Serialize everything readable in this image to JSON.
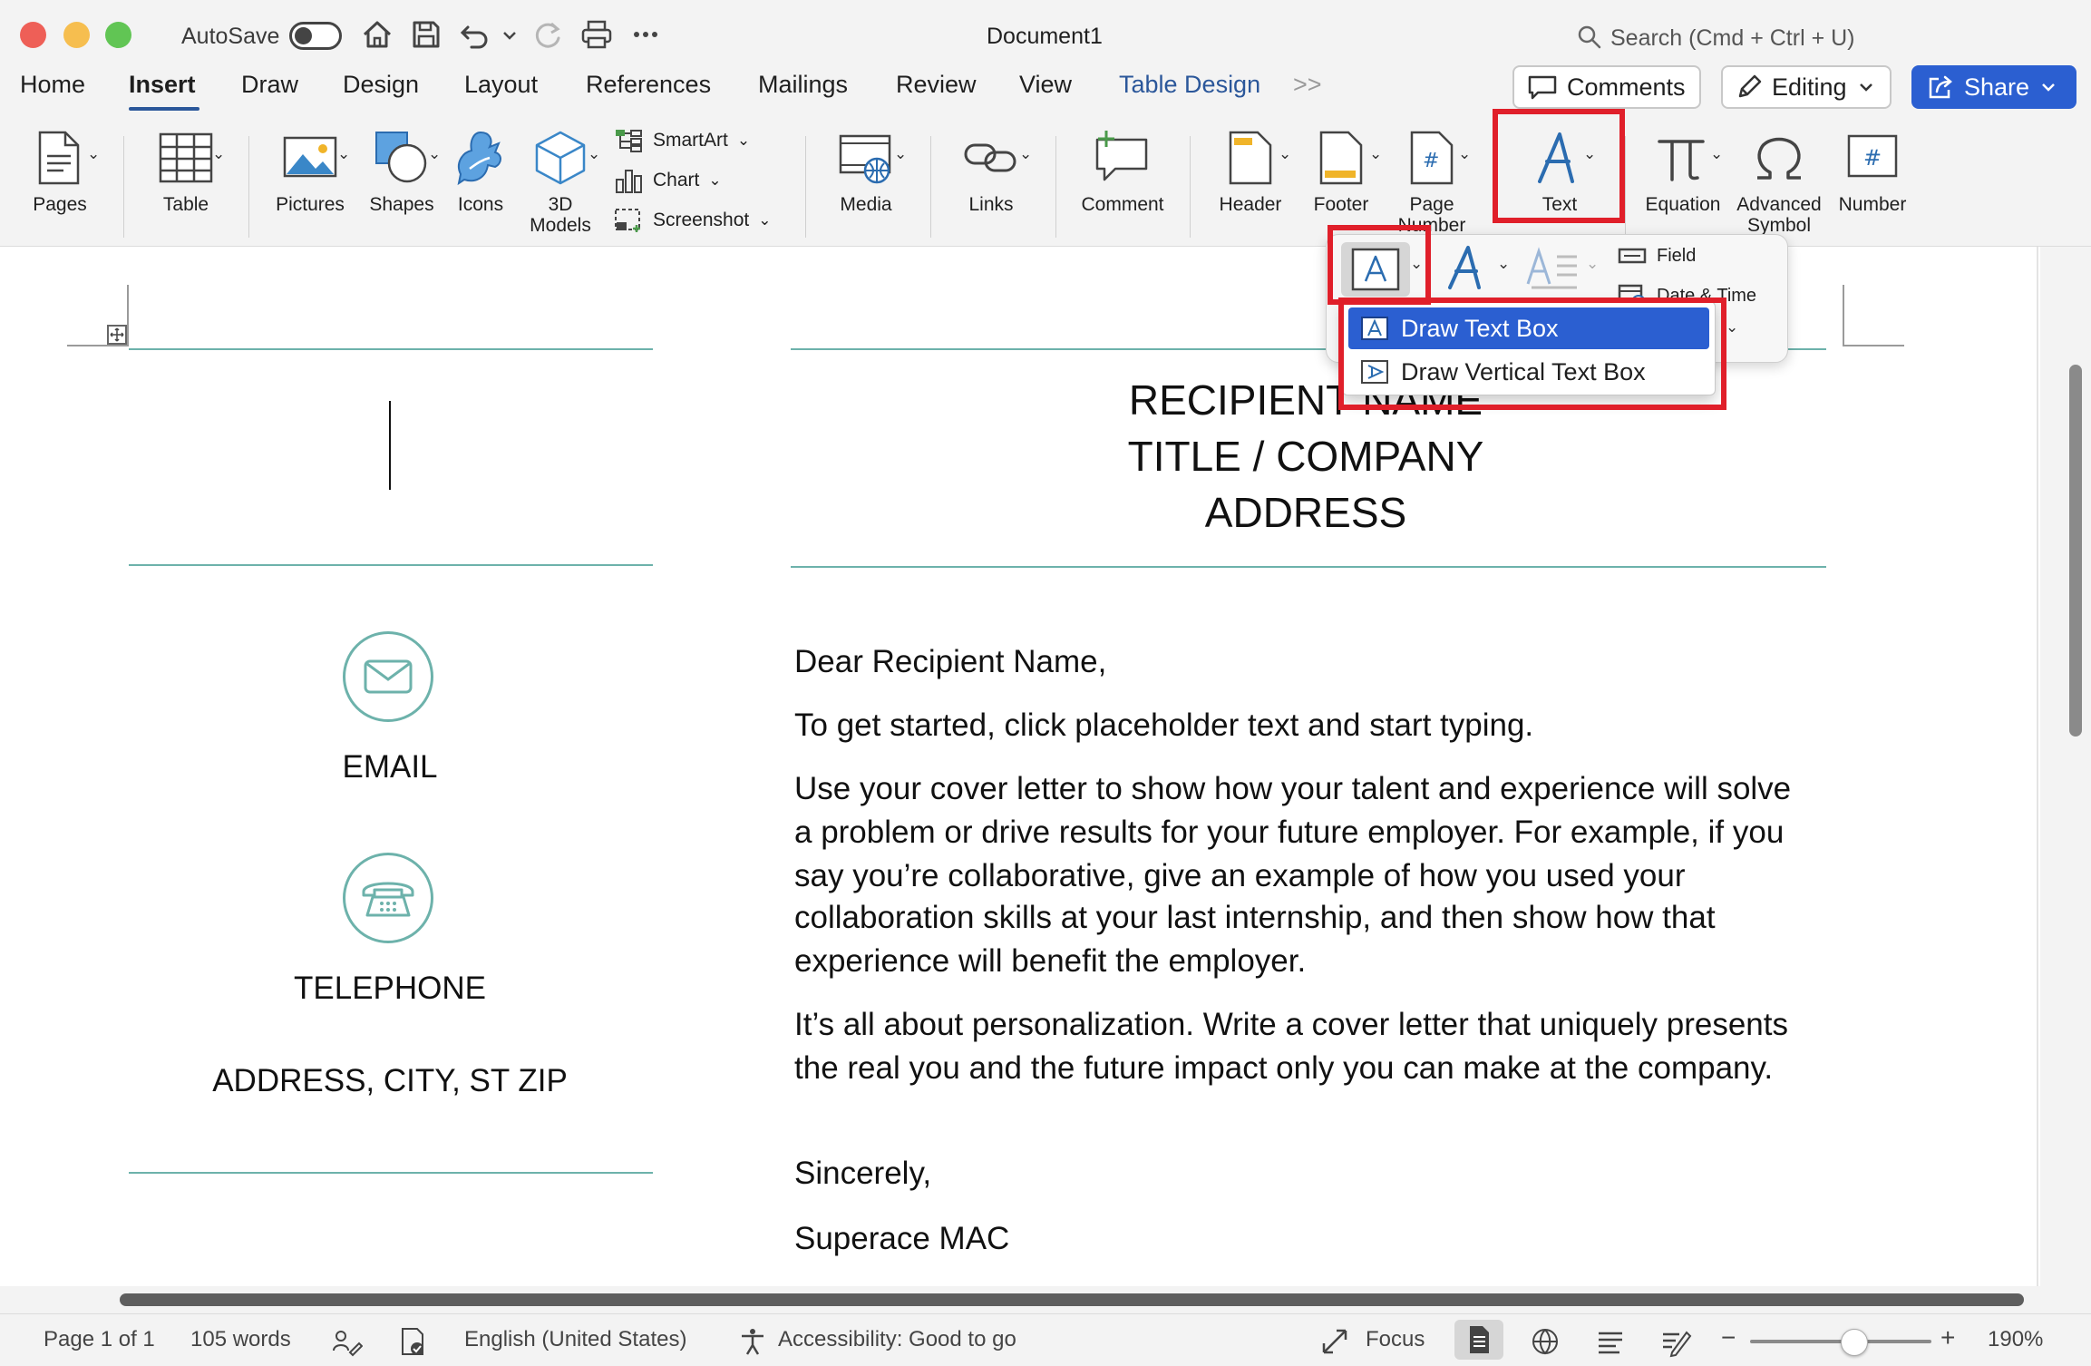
{
  "titlebar": {
    "autosave_label": "AutoSave",
    "document_title": "Document1",
    "search_placeholder": "Search (Cmd + Ctrl + U)",
    "traffic_colors": {
      "close": "#ee5f57",
      "minimize": "#f6be4f",
      "maximize": "#61c554"
    }
  },
  "tabs": [
    {
      "label": "Home"
    },
    {
      "label": "Insert"
    },
    {
      "label": "Draw"
    },
    {
      "label": "Design"
    },
    {
      "label": "Layout"
    },
    {
      "label": "References"
    },
    {
      "label": "Mailings"
    },
    {
      "label": "Review"
    },
    {
      "label": "View"
    },
    {
      "label": "Table Design"
    }
  ],
  "active_tab": "Insert",
  "tab_overflow": ">>",
  "header_buttons": {
    "comments": "Comments",
    "editing": "Editing",
    "share": "Share"
  },
  "ribbon": {
    "pages": "Pages",
    "table": "Table",
    "pictures": "Pictures",
    "shapes": "Shapes",
    "icons": "Icons",
    "models_3d_line1": "3D",
    "models_3d_line2": "Models",
    "smartart": "SmartArt",
    "chart": "Chart",
    "screenshot": "Screenshot",
    "media": "Media",
    "links": "Links",
    "comment": "Comment",
    "header": "Header",
    "footer": "Footer",
    "page_number_line1": "Page",
    "page_number_line2": "Number",
    "text": "Text",
    "equation": "Equation",
    "advanced_symbol_line1": "Advanced",
    "advanced_symbol_line2": "Symbol",
    "number": "Number",
    "field": "Field",
    "date_time": "Date & Time"
  },
  "text_menu": {
    "items": [
      {
        "label": "Draw Text Box",
        "selected": true
      },
      {
        "label": "Draw Vertical Text Box",
        "selected": false
      }
    ]
  },
  "document": {
    "heading": [
      "RECIPIENT NAME",
      "TITLE / COMPANY",
      "ADDRESS"
    ],
    "left_column": {
      "email": "EMAIL",
      "telephone": "TELEPHONE",
      "address": "ADDRESS, CITY, ST ZIP"
    },
    "body": {
      "greeting": "Dear Recipient Name,",
      "intro": "To get started, click placeholder text and start typing.",
      "paragraph1_lines": [
        "Use your cover letter to show how your talent and experience will solve",
        "a problem or drive results for your future employer. For example, if you",
        "say you’re collaborative, give an example of how you used your",
        "collaboration skills at your last internship, and then show how that",
        "experience will benefit the employer."
      ],
      "paragraph2_lines": [
        "It’s all about personalization. Write a cover letter that uniquely presents",
        "the real you and the future impact only you can make at the company."
      ],
      "closing": "Sincerely,",
      "signature": "Superace MAC"
    }
  },
  "statusbar": {
    "page": "Page 1 of 1",
    "words": "105 words",
    "language": "English (United States)",
    "accessibility": "Accessibility: Good to go",
    "focus": "Focus",
    "zoom": "190%",
    "zoom_minus": "−",
    "zoom_plus": "+"
  },
  "colors": {
    "accent_blue": "#2b579a",
    "share_blue": "#2b5fd1",
    "teal": "#6db2ab",
    "highlight_red": "#e01f2a"
  }
}
